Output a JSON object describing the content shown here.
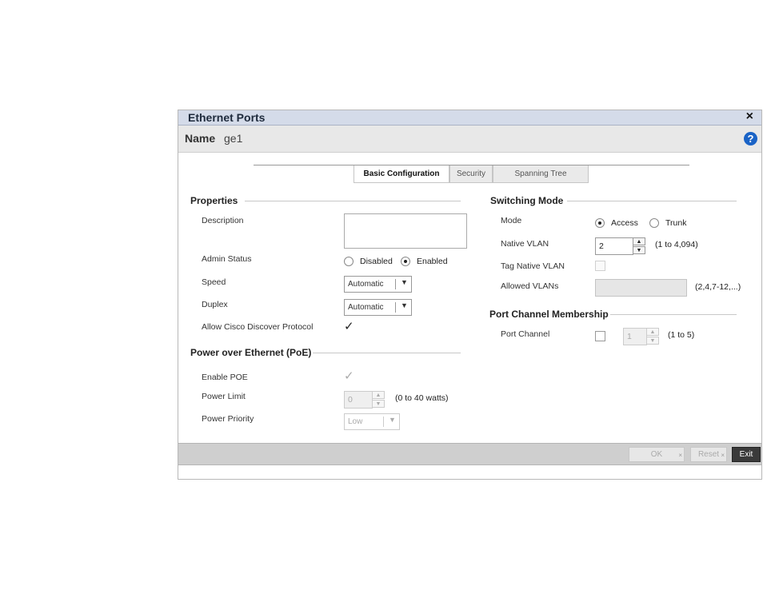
{
  "dialog": {
    "title": "Ethernet Ports",
    "name_label": "Name",
    "name_value": "ge1",
    "help_symbol": "?",
    "close_symbol": "×"
  },
  "tabs": [
    {
      "label": "Basic Configuration",
      "active": true
    },
    {
      "label": "Security",
      "active": false
    },
    {
      "label": "Spanning Tree",
      "active": false
    }
  ],
  "properties": {
    "section": "Properties",
    "description_label": "Description",
    "description_value": "",
    "admin_status_label": "Admin Status",
    "admin_status_options": [
      "Disabled",
      "Enabled"
    ],
    "admin_status_selected": "Enabled",
    "speed_label": "Speed",
    "speed_value": "Automatic",
    "duplex_label": "Duplex",
    "duplex_value": "Automatic",
    "cdp_label": "Allow Cisco Discover Protocol",
    "cdp_checked": true
  },
  "poe": {
    "section": "Power over Ethernet (PoE)",
    "enable_label": "Enable POE",
    "enable_checked": true,
    "power_limit_label": "Power Limit",
    "power_limit_value": "0",
    "power_limit_range": "(0 to 40 watts)",
    "power_priority_label": "Power Priority",
    "power_priority_value": "Low"
  },
  "switching": {
    "section": "Switching Mode",
    "mode_label": "Mode",
    "mode_options": [
      "Access",
      "Trunk"
    ],
    "mode_selected": "Access",
    "native_vlan_label": "Native VLAN",
    "native_vlan_value": "2",
    "native_vlan_range": "(1 to 4,094)",
    "tag_native_label": "Tag Native VLAN",
    "tag_native_checked": false,
    "allowed_vlans_label": "Allowed VLANs",
    "allowed_vlans_value": "",
    "allowed_vlans_hint": "(2,4,7-12,...)"
  },
  "port_channel": {
    "section": "Port Channel Membership",
    "label": "Port Channel",
    "checked": false,
    "value": "1",
    "range": "(1 to 5)"
  },
  "footer": {
    "ok": "OK",
    "reset": "Reset",
    "exit": "Exit"
  },
  "icons": {
    "close": "close-icon",
    "help": "help-icon",
    "dropdown": "chevron-down-icon",
    "spin_up": "arrow-up-icon",
    "spin_down": "arrow-down-icon"
  }
}
